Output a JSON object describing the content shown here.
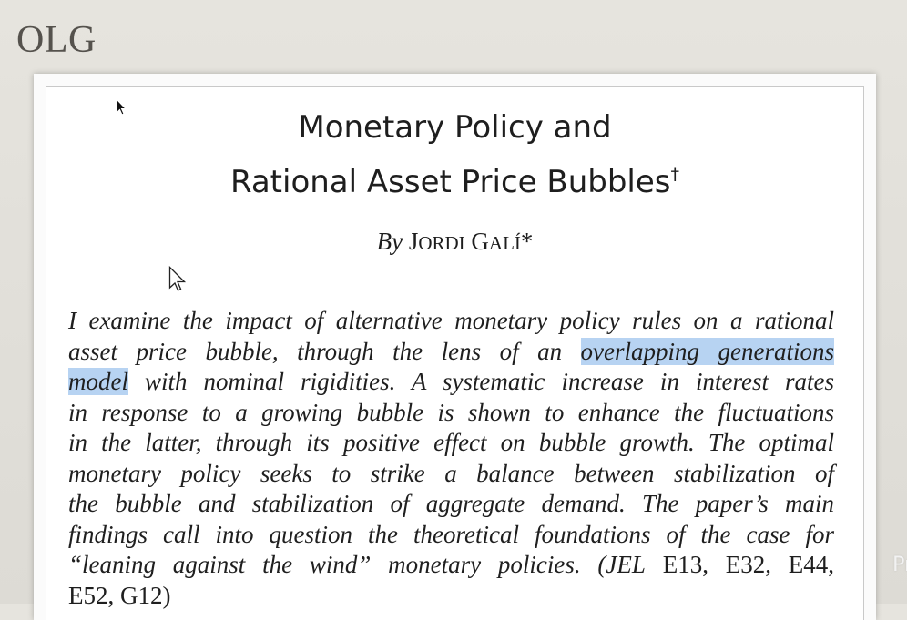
{
  "slide": {
    "title": "OLG",
    "edge_text": "Pr"
  },
  "paper": {
    "title_line1": "Monetary Policy and",
    "title_line2": "Rational Asset Price Bubbles",
    "title_mark": "†",
    "byline_by": "By",
    "author_initial_1": "J",
    "author_rest_1": "ORDI",
    "author_initial_2": "G",
    "author_rest_2": "ALÍ",
    "author_mark": "*",
    "abstract": {
      "l1": "I examine the impact of alternative monetary policy rules on a rational",
      "l2a": "asset price bubble, through the lens of an ",
      "l2b": "overlapping generations",
      "l3a": "model",
      "l3b": " with nominal rigidities. A systematic increase in interest rates",
      "l4": "in response to a growing bubble is shown to enhance the fluctuations",
      "l5": "in the latter, through its positive effect on bubble growth. The optimal",
      "l6": "monetary policy seeks to strike a balance between stabilization of",
      "l7": "the bubble and stabilization of aggregate demand. The paper’s main",
      "l8": "findings call into question the theoretical foundations of the case for",
      "l9a": "“leaning against the wind” monetary policies. (",
      "l9b": "JEL",
      "l9c": " E13, E32, E44,",
      "l10": "E52, G12)"
    }
  },
  "colors": {
    "highlight": "#b7d3f2",
    "background": "#e2e0da"
  },
  "cursors": [
    "arrow-cursor",
    "arrow-cursor"
  ]
}
